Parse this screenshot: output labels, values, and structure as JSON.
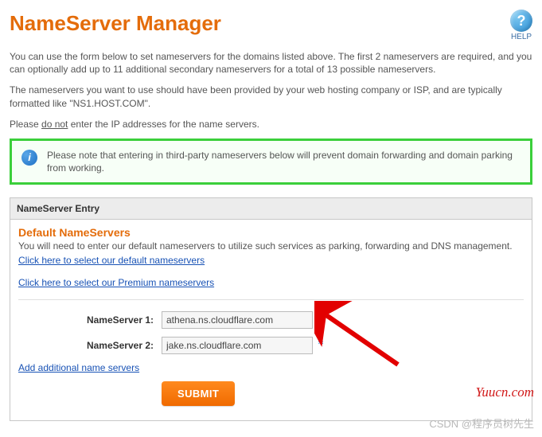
{
  "header": {
    "title": "NameServer Manager",
    "help_label": "HELP"
  },
  "intro": {
    "p1": "You can use the form below to set nameservers for the domains listed above. The first 2 nameservers are required, and you can optionally add up to 11 additional secondary nameservers for a total of 13 possible nameservers.",
    "p2": "The nameservers you want to use should have been provided by your web hosting company or ISP, and are typically formatted like \"NS1.HOST.COM\".",
    "p3_pre": "Please ",
    "p3_u": "do not",
    "p3_post": " enter the IP addresses for the name servers."
  },
  "note": {
    "text": "Please note that entering in third-party nameservers below will prevent domain forwarding and domain parking from working."
  },
  "panel": {
    "head": "NameServer Entry",
    "default_head": "Default NameServers",
    "default_text": "You will need to enter our default nameservers to utilize such services as parking, forwarding and DNS management.",
    "link_default": "Click here to select our default nameservers",
    "link_premium": "Click here to select our Premium nameservers",
    "fields": {
      "ns1_label": "NameServer 1:",
      "ns1_value": "athena.ns.cloudflare.com",
      "ns2_label": "NameServer 2:",
      "ns2_value": "jake.ns.cloudflare.com",
      "required_mark": "*"
    },
    "link_add": "Add additional name servers",
    "submit_label": "SUBMIT"
  },
  "watermarks": {
    "w1": "Yuucn.com",
    "w2": "CSDN @程序员树先生"
  }
}
